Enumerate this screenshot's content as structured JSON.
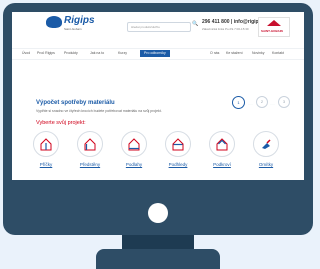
{
  "header": {
    "logo_text": "Rigips",
    "logo_sub": "Saint-Gobain",
    "search_placeholder": "Hledat produkt/službu",
    "search_button": "Hledat",
    "phone": "296 411 800 | info@rigips.cz",
    "phone_sub": "Zákaznická linka Po-Pá 7:00-15:30",
    "badge": "SAINT-GOBAIN"
  },
  "nav": {
    "items": [
      "Úvod",
      "Proč Rigips",
      "Produkty",
      "Jak na to",
      "Kurzy"
    ],
    "active": "Pro odborníky",
    "right_items": [
      "O nás",
      "Ke stažení",
      "Novinky",
      "Kontakt"
    ]
  },
  "content": {
    "title": "Výpočet spotřeby materiálu",
    "description": "Vyplňte si snadno ve čtyřech krocích budete potřebovat materiálu na svůj projekt.",
    "prompt": "Vyberte svůj projekt:",
    "steps": [
      "1",
      "2",
      "3"
    ],
    "categories": [
      {
        "label": "Příčky"
      },
      {
        "label": "Předstěny"
      },
      {
        "label": "Podlahy"
      },
      {
        "label": "Podhledy"
      },
      {
        "label": "Podkroví"
      },
      {
        "label": "Omítky"
      }
    ]
  },
  "colors": {
    "brand": "#1b5ba7",
    "accent": "#d0021b",
    "frame": "#2e4d66"
  }
}
